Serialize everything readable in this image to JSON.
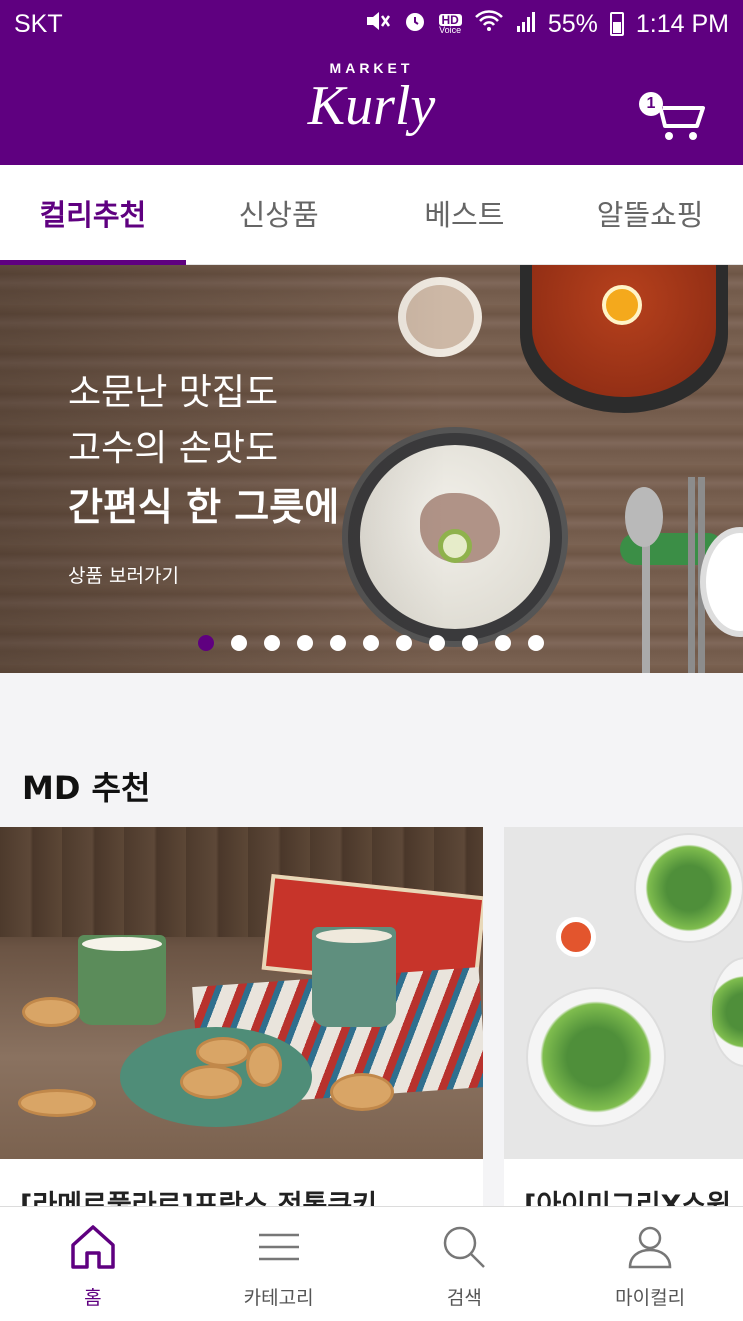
{
  "status_bar": {
    "carrier": "SKT",
    "hd_label": "HD",
    "hd_sub": "Voice",
    "battery": "55%",
    "time": "1:14 PM"
  },
  "header": {
    "logo_top": "MARKET",
    "logo_main": "Kurly",
    "cart_count": "1"
  },
  "tabs": [
    {
      "label": "컬리추천",
      "active": true
    },
    {
      "label": "신상품",
      "active": false
    },
    {
      "label": "베스트",
      "active": false
    },
    {
      "label": "알뜰쇼핑",
      "active": false
    }
  ],
  "banner": {
    "line1": "소문난 맛집도",
    "line2": "고수의 손맛도",
    "line3": "간편식 한 그릇에",
    "cta": "상품 보러가기",
    "slide_count": 11,
    "active_slide": 1
  },
  "md_section": {
    "title": "MD 추천",
    "cards": [
      {
        "title": "[라메르풀라르]프랑스 전통쿠키"
      },
      {
        "title": "[아이미그리X스윗"
      }
    ]
  },
  "bottom_nav": [
    {
      "label": "홈",
      "icon": "home-icon",
      "active": true
    },
    {
      "label": "카테고리",
      "icon": "menu-icon",
      "active": false
    },
    {
      "label": "검색",
      "icon": "search-icon",
      "active": false
    },
    {
      "label": "마이컬리",
      "icon": "user-icon",
      "active": false
    }
  ],
  "colors": {
    "brand": "#5f0080"
  }
}
